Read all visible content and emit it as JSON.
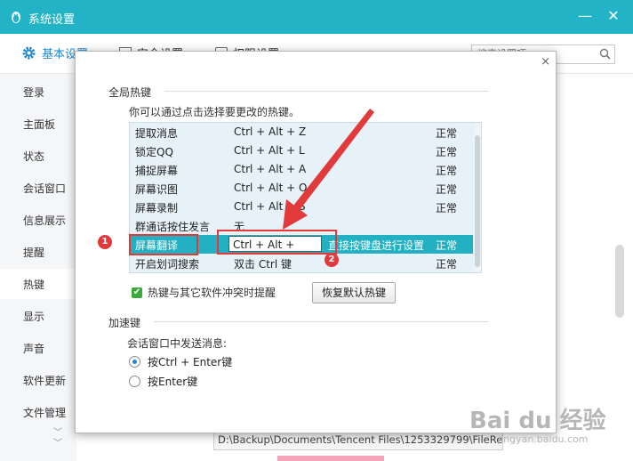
{
  "window": {
    "title": "系统设置",
    "minimize": "—",
    "close": "✕"
  },
  "topnav": {
    "tabs": [
      "基本设置",
      "安全设置",
      "权限设置"
    ],
    "search_placeholder": "搜索设置项"
  },
  "sidebar": {
    "items": [
      "登录",
      "主面板",
      "状态",
      "会话窗口",
      "信息展示",
      "提醒",
      "热键",
      "显示",
      "声音",
      "软件更新",
      "文件管理"
    ],
    "active_index": 6
  },
  "background": {
    "path_text": "D:\\Backup\\Documents\\Tencent Files\\1253329799\\FileRecv"
  },
  "dialog": {
    "close": "×",
    "section_global": "全局热键",
    "description": "你可以通过点击选择要更改的热键。",
    "hotkeys": [
      {
        "name": "提取消息",
        "key": "Ctrl + Alt + Z",
        "status": "正常"
      },
      {
        "name": "锁定QQ",
        "key": "Ctrl + Alt + L",
        "status": "正常"
      },
      {
        "name": "捕捉屏幕",
        "key": "Ctrl + Alt + A",
        "status": "正常"
      },
      {
        "name": "屏幕识图",
        "key": "Ctrl + Alt + O",
        "status": "正常"
      },
      {
        "name": "屏幕录制",
        "key": "Ctrl + Alt + S",
        "status": "正常"
      },
      {
        "name": "群通话按住发言",
        "key": "无",
        "status": ""
      },
      {
        "name": "屏幕翻译",
        "key": "Ctrl + Alt + ",
        "hint": "直接按键盘进行设置",
        "status": "正常",
        "selected": true
      },
      {
        "name": "开启划词搜索",
        "key": "双击 Ctrl 键",
        "status": "正常"
      }
    ],
    "conflict_checkbox": {
      "label": "热键与其它软件冲突时提醒",
      "checked": true
    },
    "restore_button": "恢复默认热键",
    "section_accel": "加速键",
    "send_label": "会话窗口中发送消息:",
    "send_options": [
      {
        "label": "按Ctrl + Enter键",
        "selected": true
      },
      {
        "label": "按Enter键",
        "selected": false
      }
    ]
  },
  "annotations": {
    "badge1": "1",
    "badge2": "2"
  },
  "watermark": {
    "text": "Bai du 经验",
    "sub": "jingyan.baidu.com"
  },
  "colors": {
    "titlebar": "#22b3c6",
    "selected_row": "#23b0c2",
    "annotation_red": "#e23a3a",
    "accent_blue": "#1f87d0"
  }
}
